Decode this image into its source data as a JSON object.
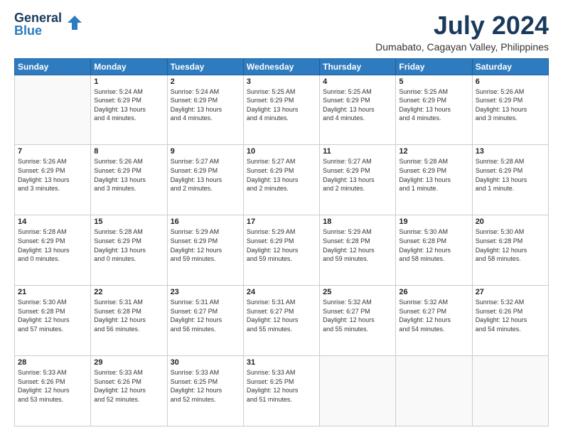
{
  "header": {
    "logo_line1": "General",
    "logo_line2": "Blue",
    "month_year": "July 2024",
    "location": "Dumabato, Cagayan Valley, Philippines"
  },
  "days_of_week": [
    "Sunday",
    "Monday",
    "Tuesday",
    "Wednesday",
    "Thursday",
    "Friday",
    "Saturday"
  ],
  "weeks": [
    [
      {
        "day": "",
        "info": ""
      },
      {
        "day": "1",
        "info": "Sunrise: 5:24 AM\nSunset: 6:29 PM\nDaylight: 13 hours\nand 4 minutes."
      },
      {
        "day": "2",
        "info": "Sunrise: 5:24 AM\nSunset: 6:29 PM\nDaylight: 13 hours\nand 4 minutes."
      },
      {
        "day": "3",
        "info": "Sunrise: 5:25 AM\nSunset: 6:29 PM\nDaylight: 13 hours\nand 4 minutes."
      },
      {
        "day": "4",
        "info": "Sunrise: 5:25 AM\nSunset: 6:29 PM\nDaylight: 13 hours\nand 4 minutes."
      },
      {
        "day": "5",
        "info": "Sunrise: 5:25 AM\nSunset: 6:29 PM\nDaylight: 13 hours\nand 4 minutes."
      },
      {
        "day": "6",
        "info": "Sunrise: 5:26 AM\nSunset: 6:29 PM\nDaylight: 13 hours\nand 3 minutes."
      }
    ],
    [
      {
        "day": "7",
        "info": "Sunrise: 5:26 AM\nSunset: 6:29 PM\nDaylight: 13 hours\nand 3 minutes."
      },
      {
        "day": "8",
        "info": "Sunrise: 5:26 AM\nSunset: 6:29 PM\nDaylight: 13 hours\nand 3 minutes."
      },
      {
        "day": "9",
        "info": "Sunrise: 5:27 AM\nSunset: 6:29 PM\nDaylight: 13 hours\nand 2 minutes."
      },
      {
        "day": "10",
        "info": "Sunrise: 5:27 AM\nSunset: 6:29 PM\nDaylight: 13 hours\nand 2 minutes."
      },
      {
        "day": "11",
        "info": "Sunrise: 5:27 AM\nSunset: 6:29 PM\nDaylight: 13 hours\nand 2 minutes."
      },
      {
        "day": "12",
        "info": "Sunrise: 5:28 AM\nSunset: 6:29 PM\nDaylight: 13 hours\nand 1 minute."
      },
      {
        "day": "13",
        "info": "Sunrise: 5:28 AM\nSunset: 6:29 PM\nDaylight: 13 hours\nand 1 minute."
      }
    ],
    [
      {
        "day": "14",
        "info": "Sunrise: 5:28 AM\nSunset: 6:29 PM\nDaylight: 13 hours\nand 0 minutes."
      },
      {
        "day": "15",
        "info": "Sunrise: 5:28 AM\nSunset: 6:29 PM\nDaylight: 13 hours\nand 0 minutes."
      },
      {
        "day": "16",
        "info": "Sunrise: 5:29 AM\nSunset: 6:29 PM\nDaylight: 12 hours\nand 59 minutes."
      },
      {
        "day": "17",
        "info": "Sunrise: 5:29 AM\nSunset: 6:29 PM\nDaylight: 12 hours\nand 59 minutes."
      },
      {
        "day": "18",
        "info": "Sunrise: 5:29 AM\nSunset: 6:28 PM\nDaylight: 12 hours\nand 59 minutes."
      },
      {
        "day": "19",
        "info": "Sunrise: 5:30 AM\nSunset: 6:28 PM\nDaylight: 12 hours\nand 58 minutes."
      },
      {
        "day": "20",
        "info": "Sunrise: 5:30 AM\nSunset: 6:28 PM\nDaylight: 12 hours\nand 58 minutes."
      }
    ],
    [
      {
        "day": "21",
        "info": "Sunrise: 5:30 AM\nSunset: 6:28 PM\nDaylight: 12 hours\nand 57 minutes."
      },
      {
        "day": "22",
        "info": "Sunrise: 5:31 AM\nSunset: 6:28 PM\nDaylight: 12 hours\nand 56 minutes."
      },
      {
        "day": "23",
        "info": "Sunrise: 5:31 AM\nSunset: 6:27 PM\nDaylight: 12 hours\nand 56 minutes."
      },
      {
        "day": "24",
        "info": "Sunrise: 5:31 AM\nSunset: 6:27 PM\nDaylight: 12 hours\nand 55 minutes."
      },
      {
        "day": "25",
        "info": "Sunrise: 5:32 AM\nSunset: 6:27 PM\nDaylight: 12 hours\nand 55 minutes."
      },
      {
        "day": "26",
        "info": "Sunrise: 5:32 AM\nSunset: 6:27 PM\nDaylight: 12 hours\nand 54 minutes."
      },
      {
        "day": "27",
        "info": "Sunrise: 5:32 AM\nSunset: 6:26 PM\nDaylight: 12 hours\nand 54 minutes."
      }
    ],
    [
      {
        "day": "28",
        "info": "Sunrise: 5:33 AM\nSunset: 6:26 PM\nDaylight: 12 hours\nand 53 minutes."
      },
      {
        "day": "29",
        "info": "Sunrise: 5:33 AM\nSunset: 6:26 PM\nDaylight: 12 hours\nand 52 minutes."
      },
      {
        "day": "30",
        "info": "Sunrise: 5:33 AM\nSunset: 6:25 PM\nDaylight: 12 hours\nand 52 minutes."
      },
      {
        "day": "31",
        "info": "Sunrise: 5:33 AM\nSunset: 6:25 PM\nDaylight: 12 hours\nand 51 minutes."
      },
      {
        "day": "",
        "info": ""
      },
      {
        "day": "",
        "info": ""
      },
      {
        "day": "",
        "info": ""
      }
    ]
  ]
}
